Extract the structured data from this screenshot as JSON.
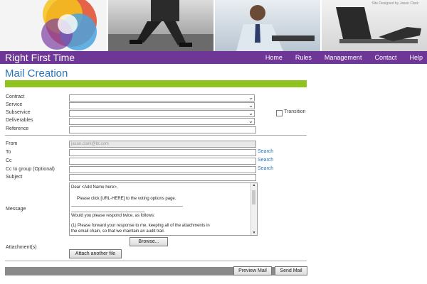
{
  "header": {
    "credit": "Site Designed by Jason Clark",
    "brand": "Right First Time",
    "nav": [
      "Home",
      "Rules",
      "Management",
      "Contact",
      "Help"
    ]
  },
  "page": {
    "title": "Mail Creation"
  },
  "form": {
    "labels": {
      "contract": "Contract",
      "service": "Service",
      "subservice": "Subservice",
      "deliverables": "Deliverables",
      "reference": "Reference",
      "from": "From",
      "to": "To",
      "cc": "Cc",
      "cc_group": "Cc to group (Optional)",
      "subject": "Subject",
      "message": "Message",
      "attachments": "Attachment(s)"
    },
    "transition_label": "Transition",
    "from_value": "jason.clark@bt.com",
    "search_label": "Search",
    "message_text": [
      "Dear <Add Name here>,",
      "",
      "Please click [URL-HERE] to the voting options page.",
      "_______________________________________________",
      "_______________________________",
      "Would you please respond twice, as follows:",
      "",
      "(1) Please forward your response to me, keeping all of the attachments in",
      "the email chain, so that we maintain an audit trail."
    ],
    "browse_label": "Browse...",
    "attach_label": "Attach another file",
    "preview_label": "Preview Mail",
    "send_label": "Send Mail"
  },
  "colors": {
    "nav_bg": "#6e3696",
    "accent_green": "#8ec320",
    "title_blue": "#2b74b9"
  }
}
